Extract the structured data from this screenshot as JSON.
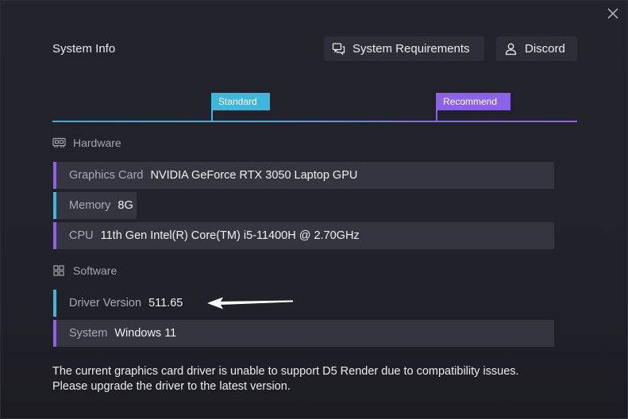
{
  "dialog": {
    "title": "System Info",
    "close_icon": "close-icon"
  },
  "header": {
    "requirements_button": {
      "label": "System Requirements",
      "icon": "chat-bubbles-icon"
    },
    "discord_button": {
      "label": "Discord",
      "icon": "user-icon"
    }
  },
  "levels": {
    "standard": "Standard",
    "recommend": "Recommend"
  },
  "hardware": {
    "heading": "Hardware",
    "icon": "hardware-chip-icon",
    "rows": [
      {
        "label": "Graphics Card",
        "value": "NVIDIA GeForce RTX 3050 Laptop GPU",
        "level": "recommend"
      },
      {
        "label": "Memory",
        "value": "8G",
        "level": "standard"
      },
      {
        "label": "CPU",
        "value": "11th Gen Intel(R) Core(TM) i5-11400H @ 2.70GHz",
        "level": "recommend"
      }
    ]
  },
  "software": {
    "heading": "Software",
    "icon": "windows-grid-icon",
    "rows": [
      {
        "label": "Driver Version",
        "value": "511.65",
        "level": "standard"
      },
      {
        "label": "System",
        "value": "Windows 11",
        "level": "recommend"
      }
    ]
  },
  "notice": {
    "line1": "The current graphics card driver is unable to support D5 Render due to compatibility issues.",
    "line2": "Please upgrade the driver to the latest version."
  },
  "colors": {
    "standard": "#3fb6dc",
    "recommend": "#8c63e8",
    "row_bg": "#353540",
    "background": "#202028"
  }
}
